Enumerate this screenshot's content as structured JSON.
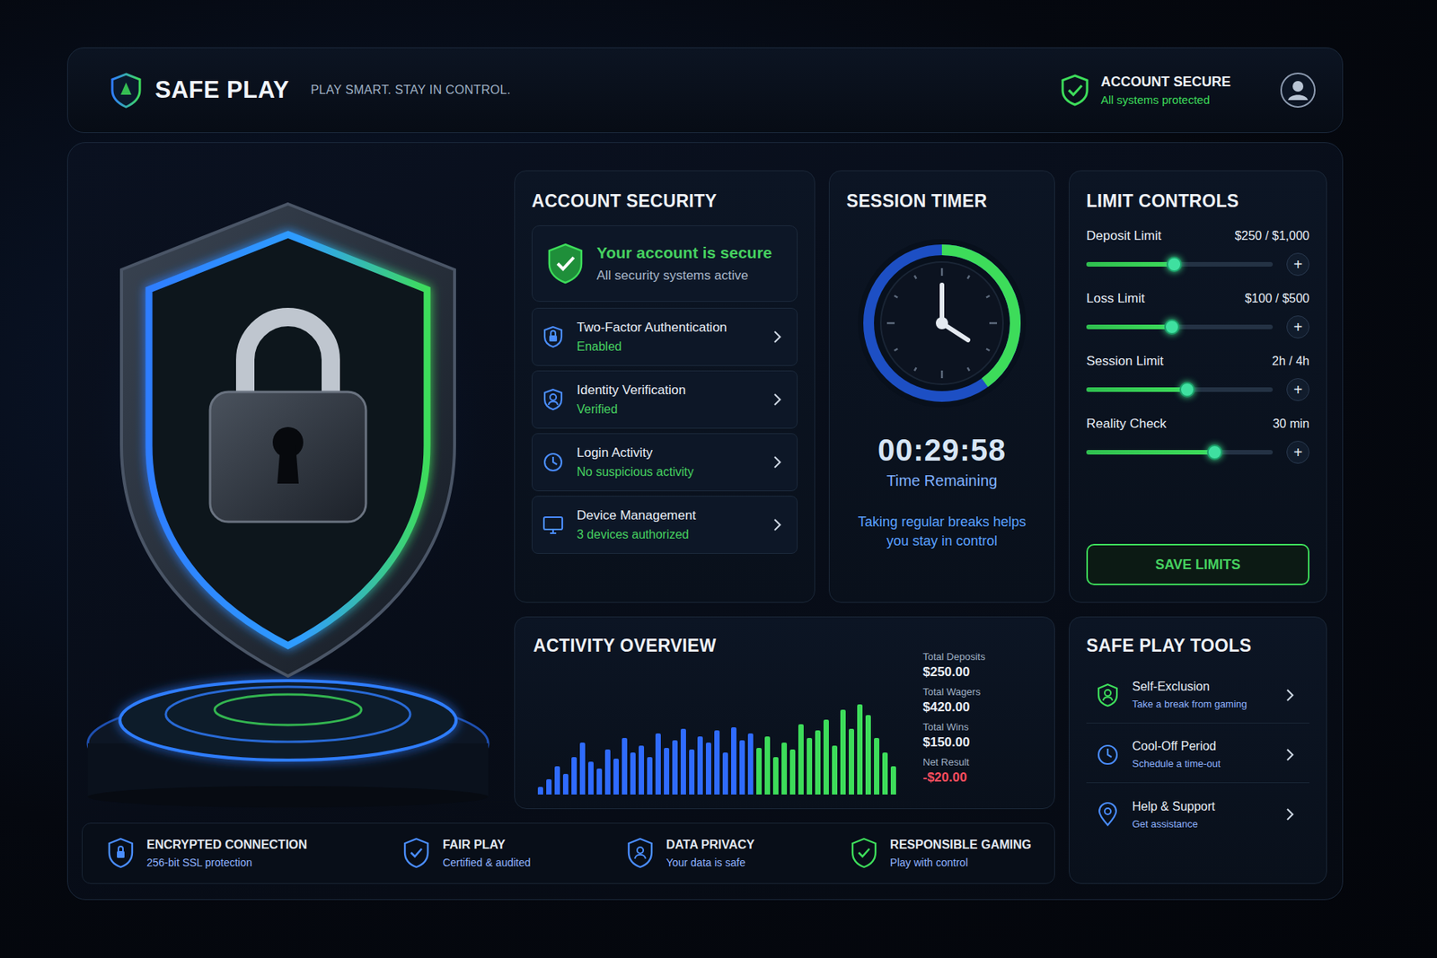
{
  "brand": {
    "name": "SAFE PLAY",
    "tagline": "PLAY SMART. STAY IN CONTROL."
  },
  "header_status": {
    "title": "ACCOUNT SECURE",
    "subtitle": "All systems protected"
  },
  "account_security": {
    "title": "ACCOUNT SECURITY",
    "summary": {
      "title": "Your account is secure",
      "subtitle": "All security systems active"
    },
    "items": [
      {
        "label": "Two-Factor Authentication",
        "status": "Enabled"
      },
      {
        "label": "Identity Verification",
        "status": "Verified"
      },
      {
        "label": "Login Activity",
        "status": "No suspicious activity"
      },
      {
        "label": "Device Management",
        "status": "3 devices authorized"
      }
    ]
  },
  "session_timer": {
    "title": "SESSION TIMER",
    "time": "00:29:58",
    "caption": "Time Remaining",
    "tip": "Taking regular breaks helps you stay in control",
    "level": 0.4
  },
  "limit_controls": {
    "title": "LIMIT CONTROLS",
    "items": [
      {
        "label": "Deposit Limit",
        "reading": "$250 / $1,000",
        "level": 0.47,
        "button": "+"
      },
      {
        "label": "Loss Limit",
        "reading": "$100 / $500",
        "level": 0.46,
        "button": "+"
      },
      {
        "label": "Session Limit",
        "reading": "2h / 4h",
        "level": 0.54,
        "button": "+"
      },
      {
        "label": "Reality Check",
        "reading": "30 min",
        "level": 0.69,
        "button": "+"
      }
    ],
    "save_button": "SAVE LIMITS"
  },
  "activity": {
    "title": "ACTIVITY OVERVIEW",
    "chart": {
      "series": [
        {
          "color": "#2f6bff",
          "values": [
            8,
            16,
            30,
            22,
            40,
            55,
            35,
            28,
            48,
            38,
            60,
            45,
            52,
            40,
            65,
            50,
            58,
            70,
            48,
            62,
            55,
            68,
            45,
            72,
            58,
            65
          ]
        },
        {
          "color": "#3ddc5a",
          "values": [
            50,
            62,
            40,
            55,
            48,
            75,
            60,
            68,
            80,
            52,
            90,
            70,
            96,
            85,
            60,
            45,
            30
          ]
        }
      ]
    },
    "stats": [
      {
        "label": "Total Deposits",
        "value": "$250.00",
        "color": "#e8eef6"
      },
      {
        "label": "Total Wagers",
        "value": "$420.00",
        "color": "#e8eef6"
      },
      {
        "label": "Total Wins",
        "value": "$150.00",
        "color": "#e8eef6"
      },
      {
        "label": "Net Result",
        "value": "-$20.00",
        "color": "#ff4d5e"
      }
    ]
  },
  "tools": {
    "title": "SAFE PLAY TOOLS",
    "items": [
      {
        "label": "Self-Exclusion",
        "description": "Take a break from gaming"
      },
      {
        "label": "Cool-Off Period",
        "description": "Schedule a time-out"
      },
      {
        "label": "Help & Support",
        "description": "Get assistance"
      }
    ]
  },
  "badges": [
    {
      "title": "ENCRYPTED CONNECTION",
      "subtitle": "256-bit SSL protection"
    },
    {
      "title": "FAIR PLAY",
      "subtitle": "Certified & audited"
    },
    {
      "title": "DATA PRIVACY",
      "subtitle": "Your data is safe"
    },
    {
      "title": "RESPONSIBLE GAMING",
      "subtitle": "Play with control"
    }
  ]
}
